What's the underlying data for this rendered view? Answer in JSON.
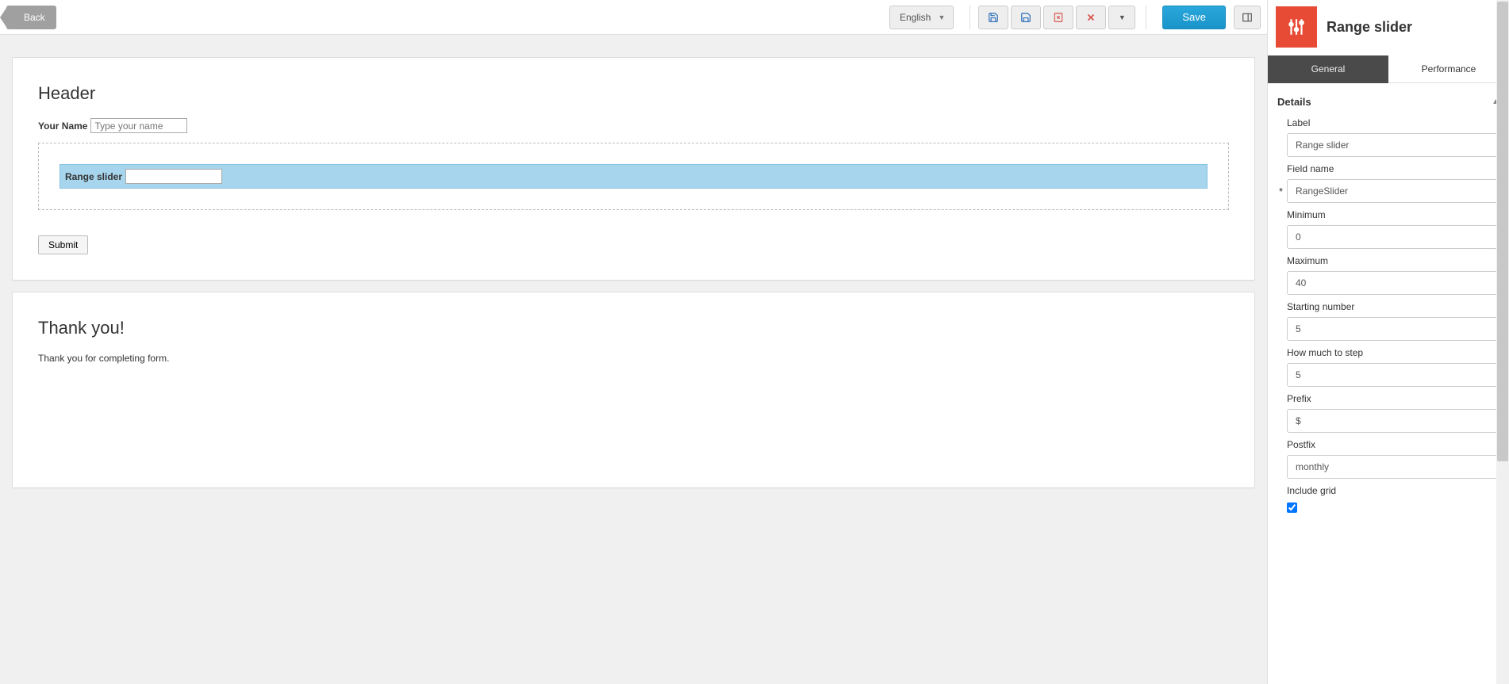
{
  "topbar": {
    "back_label": "Back",
    "language": "English",
    "save_label": "Save"
  },
  "form_panel": {
    "header": "Header",
    "name_label": "Your Name",
    "name_placeholder": "Type your name",
    "slider_field_label": "Range slider",
    "submit_label": "Submit"
  },
  "thankyou_panel": {
    "title": "Thank you!",
    "text": "Thank you for completing form."
  },
  "sidebar": {
    "title": "Range slider",
    "tabs": {
      "general": "General",
      "performance": "Performance"
    },
    "section_details": "Details",
    "fields": {
      "label": {
        "label": "Label",
        "value": "Range slider"
      },
      "field_name": {
        "label": "Field name",
        "value": "RangeSlider",
        "required": "*"
      },
      "minimum": {
        "label": "Minimum",
        "value": "0"
      },
      "maximum": {
        "label": "Maximum",
        "value": "40"
      },
      "starting": {
        "label": "Starting number",
        "value": "5"
      },
      "step": {
        "label": "How much to step",
        "value": "5"
      },
      "prefix": {
        "label": "Prefix",
        "value": "$"
      },
      "postfix": {
        "label": "Postfix",
        "value": "monthly"
      },
      "include_grid": {
        "label": "Include grid"
      }
    }
  }
}
